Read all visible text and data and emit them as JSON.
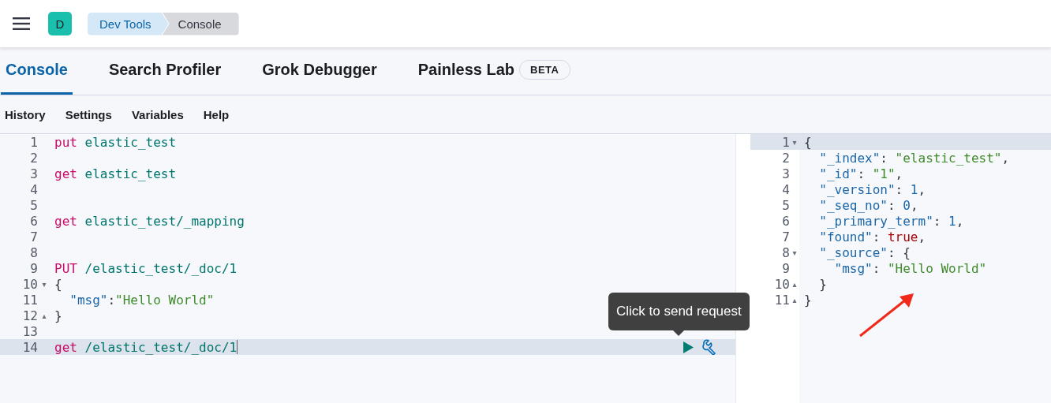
{
  "header": {
    "avatar": "D",
    "breadcrumbs": [
      {
        "label": "Dev Tools",
        "selected": false
      },
      {
        "label": "Console",
        "selected": true
      }
    ]
  },
  "tabs": [
    {
      "label": "Console",
      "selected": true
    },
    {
      "label": "Search Profiler",
      "selected": false
    },
    {
      "label": "Grok Debugger",
      "selected": false
    },
    {
      "label": "Painless Lab",
      "selected": false,
      "badge": "BETA"
    }
  ],
  "menu": [
    "History",
    "Settings",
    "Variables",
    "Help"
  ],
  "request_editor": {
    "lines": [
      {
        "number": "1",
        "active": false,
        "tokens": [
          {
            "text": "put",
            "kind": "method"
          },
          {
            "text": " elastic_test",
            "kind": "path"
          }
        ]
      },
      {
        "number": "2",
        "active": false
      },
      {
        "number": "3",
        "active": false,
        "tokens": [
          {
            "text": "get",
            "kind": "method"
          },
          {
            "text": " elastic_test",
            "kind": "path"
          }
        ]
      },
      {
        "number": "4",
        "active": false
      },
      {
        "number": "5",
        "active": false
      },
      {
        "number": "6",
        "active": false,
        "tokens": [
          {
            "text": "get",
            "kind": "method"
          },
          {
            "text": " elastic_test/_mapping",
            "kind": "path"
          }
        ]
      },
      {
        "number": "7",
        "active": false
      },
      {
        "number": "8",
        "active": false
      },
      {
        "number": "9",
        "active": false,
        "tokens": [
          {
            "text": "PUT",
            "kind": "method"
          },
          {
            "text": " /elastic_test/_doc/1",
            "kind": "path"
          }
        ]
      },
      {
        "number": "10",
        "active": false,
        "fold": "▾",
        "tokens": [
          {
            "text": "{",
            "kind": "punct"
          }
        ]
      },
      {
        "number": "11",
        "active": false,
        "tokens": [
          {
            "text": "  \"msg\"",
            "kind": "key"
          },
          {
            "text": ":",
            "kind": "punct"
          },
          {
            "text": "\"Hello World\"",
            "kind": "string"
          }
        ]
      },
      {
        "number": "12",
        "active": false,
        "fold": "▴",
        "tokens": [
          {
            "text": "}",
            "kind": "punct"
          }
        ]
      },
      {
        "number": "13",
        "active": false
      },
      {
        "number": "14",
        "active": true,
        "tokens": [
          {
            "text": "get",
            "kind": "method"
          },
          {
            "text": " /elastic_test/_doc/1",
            "kind": "path"
          }
        ]
      }
    ],
    "tooltip": "Click to send request"
  },
  "response_editor": {
    "lines": [
      {
        "number": "1",
        "active": true,
        "fold": "▾",
        "tokens": [
          {
            "text": "{",
            "kind": "punct"
          }
        ]
      },
      {
        "number": "2",
        "active": false,
        "tokens": [
          {
            "text": "  \"_index\"",
            "kind": "key"
          },
          {
            "text": ": ",
            "kind": "punct"
          },
          {
            "text": "\"elastic_test\"",
            "kind": "string"
          },
          {
            "text": ",",
            "kind": "punct"
          }
        ]
      },
      {
        "number": "3",
        "active": false,
        "tokens": [
          {
            "text": "  \"_id\"",
            "kind": "key"
          },
          {
            "text": ": ",
            "kind": "punct"
          },
          {
            "text": "\"1\"",
            "kind": "string"
          },
          {
            "text": ",",
            "kind": "punct"
          }
        ]
      },
      {
        "number": "4",
        "active": false,
        "tokens": [
          {
            "text": "  \"_version\"",
            "kind": "key"
          },
          {
            "text": ": ",
            "kind": "punct"
          },
          {
            "text": "1",
            "kind": "number"
          },
          {
            "text": ",",
            "kind": "punct"
          }
        ]
      },
      {
        "number": "5",
        "active": false,
        "tokens": [
          {
            "text": "  \"_seq_no\"",
            "kind": "key"
          },
          {
            "text": ": ",
            "kind": "punct"
          },
          {
            "text": "0",
            "kind": "number"
          },
          {
            "text": ",",
            "kind": "punct"
          }
        ]
      },
      {
        "number": "6",
        "active": false,
        "tokens": [
          {
            "text": "  \"_primary_term\"",
            "kind": "key"
          },
          {
            "text": ": ",
            "kind": "punct"
          },
          {
            "text": "1",
            "kind": "number"
          },
          {
            "text": ",",
            "kind": "punct"
          }
        ]
      },
      {
        "number": "7",
        "active": false,
        "tokens": [
          {
            "text": "  \"found\"",
            "kind": "key"
          },
          {
            "text": ": ",
            "kind": "punct"
          },
          {
            "text": "true",
            "kind": "boolean"
          },
          {
            "text": ",",
            "kind": "punct"
          }
        ]
      },
      {
        "number": "8",
        "active": false,
        "fold": "▾",
        "tokens": [
          {
            "text": "  \"_source\"",
            "kind": "key"
          },
          {
            "text": ": {",
            "kind": "punct"
          }
        ]
      },
      {
        "number": "9",
        "active": false,
        "tokens": [
          {
            "text": "    \"msg\"",
            "kind": "key"
          },
          {
            "text": ": ",
            "kind": "punct"
          },
          {
            "text": "\"Hello World\"",
            "kind": "string"
          }
        ]
      },
      {
        "number": "10",
        "active": false,
        "fold": "▴",
        "tokens": [
          {
            "text": "  }",
            "kind": "punct"
          }
        ]
      },
      {
        "number": "11",
        "active": false,
        "fold": "▴",
        "tokens": [
          {
            "text": "}",
            "kind": "punct"
          }
        ]
      }
    ]
  }
}
